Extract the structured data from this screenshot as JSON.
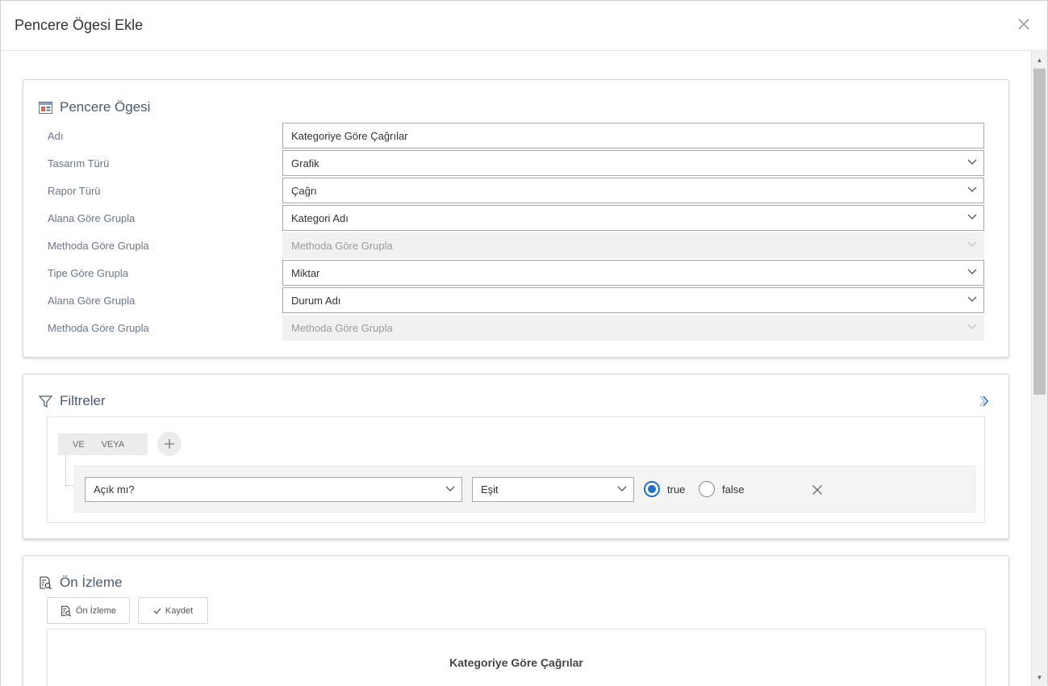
{
  "dialog": {
    "title": "Pencere Ögesi Ekle",
    "close_label": "×"
  },
  "widget_panel": {
    "title": "Pencere Ögesi",
    "fields": [
      {
        "label": "Adı",
        "value": "Kategoriye Göre Çağrılar",
        "type": "text",
        "disabled": false
      },
      {
        "label": "Tasarım Türü",
        "value": "Grafik",
        "type": "select",
        "disabled": false
      },
      {
        "label": "Rapor Türü",
        "value": "Çağrı",
        "type": "select",
        "disabled": false
      },
      {
        "label": "Alana Göre Grupla",
        "value": "Kategori Adı",
        "type": "select",
        "disabled": false
      },
      {
        "label": "Methoda Göre Grupla",
        "value": "Methoda Göre Grupla",
        "type": "select",
        "disabled": true
      },
      {
        "label": "Tipe Göre Grupla",
        "value": "Miktar",
        "type": "select",
        "disabled": false
      },
      {
        "label": "Alana Göre Grupla",
        "value": "Durum Adı",
        "type": "select",
        "disabled": false
      },
      {
        "label": "Methoda Göre Grupla",
        "value": "Methoda Göre Grupla",
        "type": "select",
        "disabled": true
      }
    ]
  },
  "filters_panel": {
    "title": "Filtreler",
    "logic": {
      "and_label": "VE",
      "or_label": "VEYA"
    },
    "rule": {
      "field": "Açık mı?",
      "operator": "Eşit",
      "options": [
        {
          "label": "true",
          "checked": true
        },
        {
          "label": "false",
          "checked": false
        }
      ]
    }
  },
  "preview_panel": {
    "title": "Ön İzleme",
    "preview_button": "Ön İzleme",
    "save_button": "Kaydet",
    "chart_title": "Kategoriye Göre Çağrılar"
  },
  "colors": {
    "accent": "#1f73c6",
    "panel_title": "#4a5a70",
    "label": "#6b7689"
  }
}
